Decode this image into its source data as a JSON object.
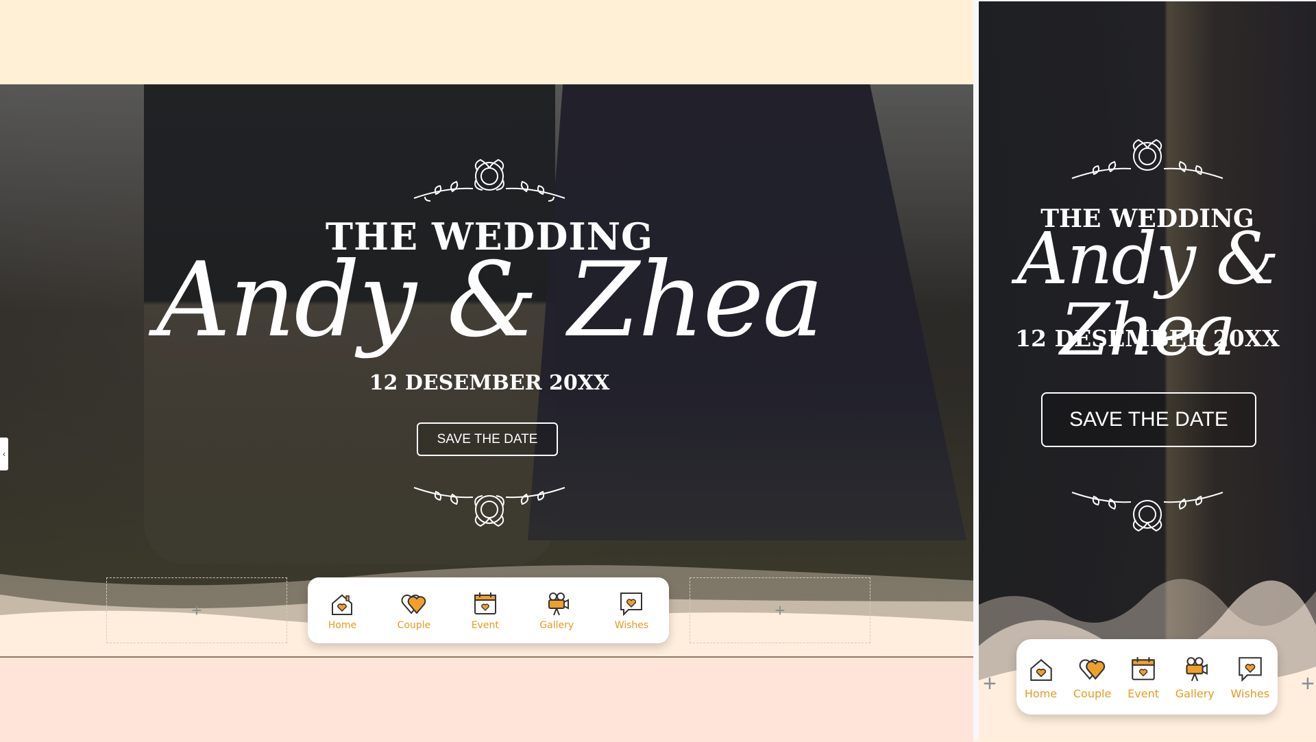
{
  "desktop": {
    "hero": {
      "title": "THE WEDDING",
      "names": "Andy & Zhea",
      "date": "12 DESEMBER 20XX",
      "save_button": "SAVE THE DATE"
    },
    "placeholders": {
      "left": "+",
      "right": "+"
    },
    "side_handle": "‹"
  },
  "mobile": {
    "hero": {
      "title": "THE WEDDING",
      "names": "Andy & Zhea",
      "date": "12 DESEMBER 20XX",
      "save_button": "SAVE THE DATE"
    },
    "plus_left": "+",
    "plus_right": "+"
  },
  "nav": {
    "items": [
      {
        "label": "Home",
        "icon": "home-heart-icon"
      },
      {
        "label": "Couple",
        "icon": "hearts-icon"
      },
      {
        "label": "Event",
        "icon": "calendar-heart-icon"
      },
      {
        "label": "Gallery",
        "icon": "video-camera-icon"
      },
      {
        "label": "Wishes",
        "icon": "chat-heart-icon"
      }
    ]
  },
  "colors": {
    "accent": "#e79a1f",
    "top_band": "#fff0d6",
    "bottom_band": "#ffe4da",
    "wave": "#ffeedd"
  }
}
